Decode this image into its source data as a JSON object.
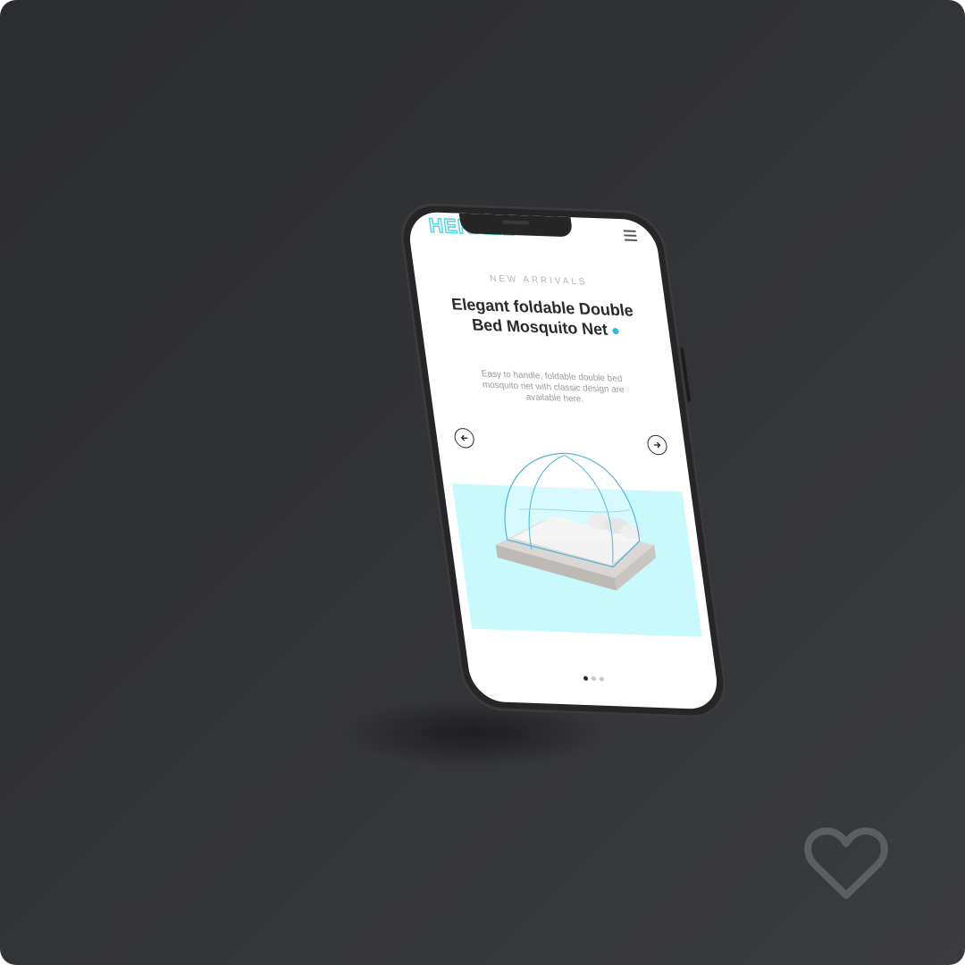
{
  "brand": {
    "logo_text": "HERKEL"
  },
  "hero": {
    "eyebrow": "NEW ARRIVALS",
    "title": "Elegant foldable Double Bed Mosquito Net",
    "description": "Easy to handle, foldable double bed mosquito net with classic design are available here."
  },
  "carousel": {
    "prev_icon": "arrow-left-icon",
    "next_icon": "arrow-right-icon",
    "slide_count": 3,
    "active_index": 0
  },
  "icons": {
    "menu": "hamburger-menu-icon",
    "favorite": "heart-icon"
  },
  "colors": {
    "accent": "#2bbbe0",
    "logo_outline": "#4fd6ec",
    "product_background": "#c8f9fd",
    "background": "#2e2f32"
  }
}
